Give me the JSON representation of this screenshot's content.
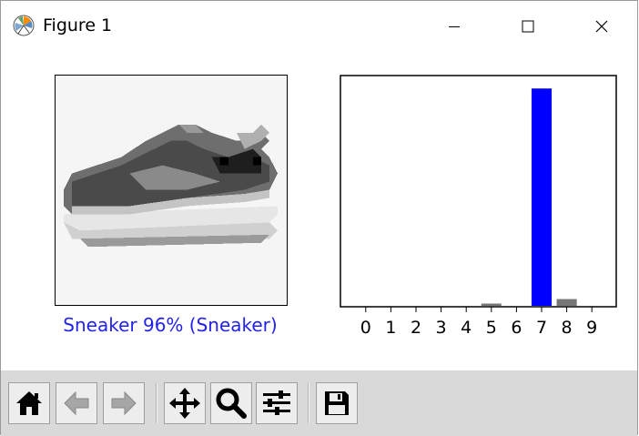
{
  "window": {
    "title": "Figure 1"
  },
  "figure": {
    "caption": "Sneaker 96% (Sneaker)",
    "caption_color": "#2222ee"
  },
  "chart_data": {
    "type": "bar",
    "categories": [
      "0",
      "1",
      "2",
      "3",
      "4",
      "5",
      "6",
      "7",
      "8",
      "9"
    ],
    "values": [
      0.0,
      0.0,
      0.0,
      0.0,
      0.0,
      0.01,
      0.0,
      0.96,
      0.03,
      0.0
    ],
    "colors": [
      "#777777",
      "#777777",
      "#777777",
      "#777777",
      "#777777",
      "#777777",
      "#777777",
      "#0000ff",
      "#777777",
      "#777777"
    ],
    "title": "",
    "xlabel": "",
    "ylabel": "",
    "ylim": [
      0,
      1
    ],
    "yticks_visible": false,
    "grid": false
  },
  "toolbar": {
    "buttons": [
      {
        "name": "home-button",
        "icon": "home-icon"
      },
      {
        "name": "back-button",
        "icon": "arrow-left-icon"
      },
      {
        "name": "forward-button",
        "icon": "arrow-right-icon"
      },
      {
        "name": "pan-button",
        "icon": "move-icon"
      },
      {
        "name": "zoom-button",
        "icon": "magnifier-icon"
      },
      {
        "name": "subplots-button",
        "icon": "sliders-icon"
      },
      {
        "name": "save-button",
        "icon": "floppy-disk-icon"
      }
    ]
  }
}
